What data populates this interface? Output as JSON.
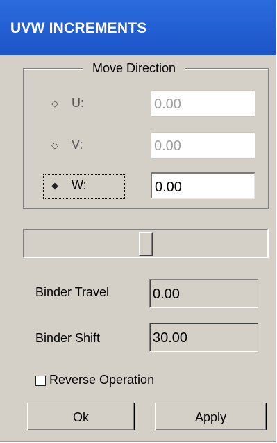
{
  "window": {
    "title": "UVW INCREMENTS"
  },
  "move_direction": {
    "title": "Move Direction",
    "rows": [
      {
        "label": "U:",
        "value": "0.00",
        "selected": false,
        "enabled": false
      },
      {
        "label": "V:",
        "value": "0.00",
        "selected": false,
        "enabled": false
      },
      {
        "label": "W:",
        "value": "0.00",
        "selected": true,
        "enabled": true
      }
    ]
  },
  "slider": {
    "level": 0.5
  },
  "binder": {
    "travel_label": "Binder Travel",
    "travel_value": "0.00",
    "shift_label": "Binder Shift",
    "shift_value": "30.00"
  },
  "reverse_operation": {
    "label": "Reverse Operation",
    "checked": false
  },
  "buttons": {
    "ok": "Ok",
    "apply": "Apply"
  },
  "colors": {
    "title_bar": "#1c55c8",
    "dialog_bg": "#d4d0c8"
  }
}
